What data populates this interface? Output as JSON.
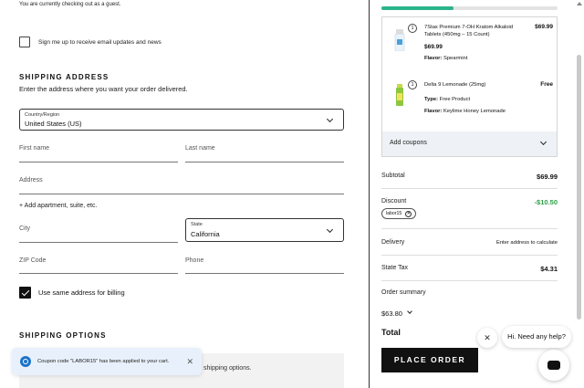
{
  "guest_notice": "You are currently checking out as a guest.",
  "newsletter": {
    "label": "Sign me up to receive email updates and news",
    "checked": false
  },
  "shipping_address": {
    "title": "SHIPPING ADDRESS",
    "subtitle": "Enter the address where you want your order delivered.",
    "country_label": "Country/Region",
    "country_value": "United States (US)",
    "first_name_placeholder": "First name",
    "last_name_placeholder": "Last name",
    "address_placeholder": "Address",
    "add_apartment": "+ Add apartment, suite, etc.",
    "city_placeholder": "City",
    "state_label": "State",
    "state_value": "California",
    "zip_placeholder": "ZIP Code",
    "phone_placeholder": "Phone"
  },
  "billing": {
    "label": "Use same address for billing",
    "checked": true
  },
  "shipping_options": {
    "title": "SHIPPING OPTIONS",
    "message_fragment": "shipping options."
  },
  "toast": {
    "message": "Coupon code \"LABOR15\" has been applied to your cart."
  },
  "cart": {
    "progress": 0.41,
    "items": [
      {
        "qty": "1",
        "name": "7Stax Premium 7-OH Kratom Alkaloid Tablets (450mg – 15 Count)",
        "price": "$69.99",
        "unit_price": "$69.99",
        "attr_label": "Flavor:",
        "attr_value": "Spearmint"
      },
      {
        "qty": "1",
        "name": "Delta 9 Lemonade (25mg)",
        "price": "Free",
        "type_label": "Type:",
        "type_value": "Free Product",
        "attr_label": "Flavor:",
        "attr_value": "Keylime Honey Lemonade"
      }
    ],
    "add_coupons": "Add coupons"
  },
  "totals": {
    "subtotal_label": "Subtotal",
    "subtotal_value": "$69.99",
    "discount_label": "Discount",
    "discount_value": "-$10.50",
    "coupon_chip": "labor15",
    "delivery_label": "Delivery",
    "delivery_value": "Enter address to calculate",
    "tax_label": "State Tax",
    "tax_value": "$4.31",
    "summary_label": "Order summary",
    "summary_amount": "$63.80",
    "total_label": "Total"
  },
  "place_order": "PLACE ORDER",
  "chat": {
    "greeting": "Hi. Need any help?"
  },
  "colors": {
    "accent_green": "#2bb38c",
    "discount_green": "#2e9e48",
    "toast_blue": "#1c73c9"
  }
}
